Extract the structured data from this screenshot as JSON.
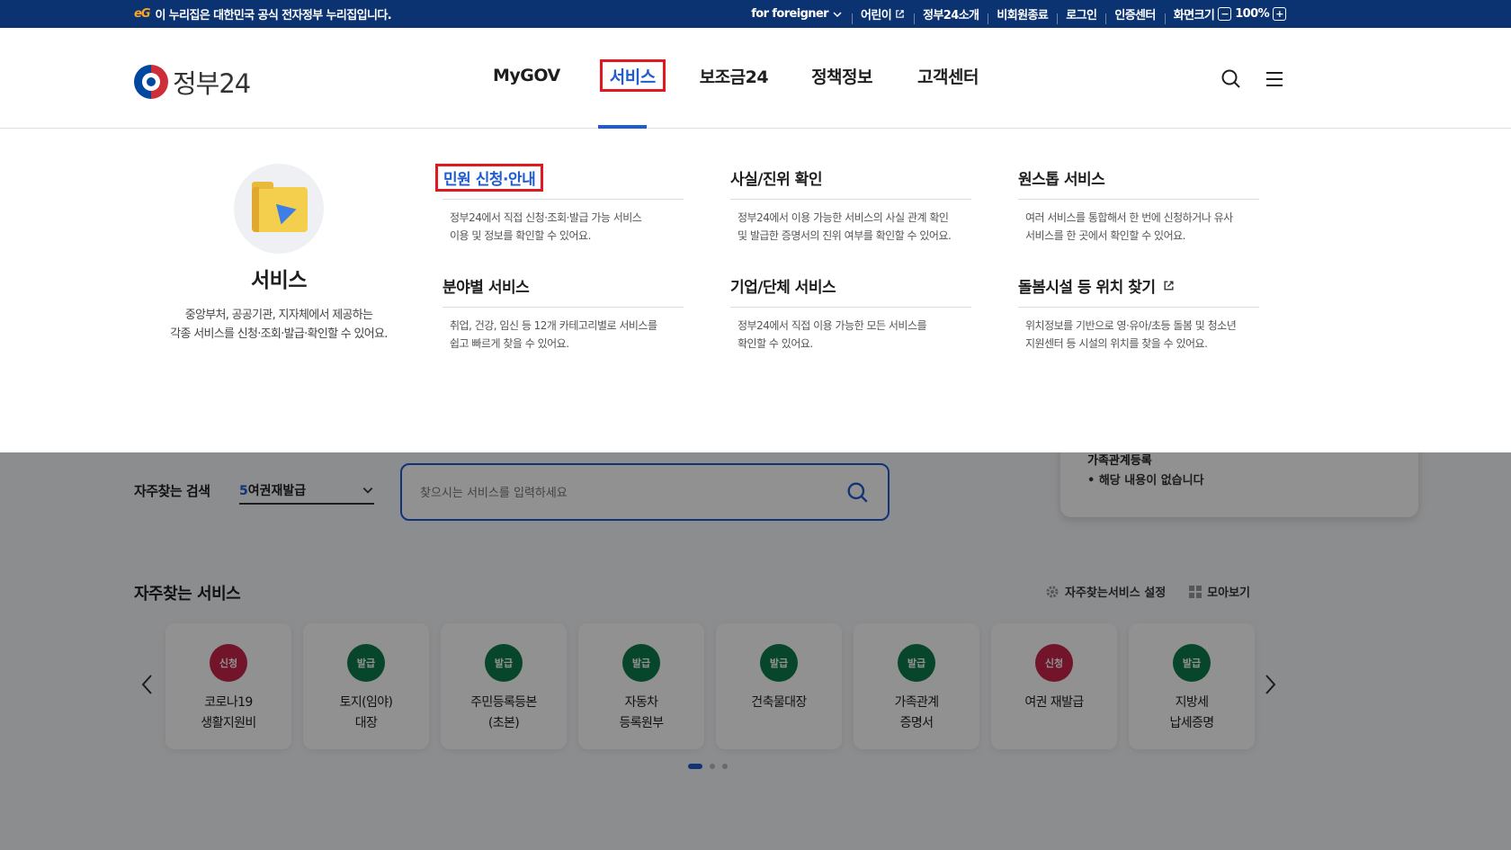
{
  "topbar": {
    "gov_logo": "eG",
    "gov_notice": "이 누리집은 대한민국 공식 전자정부 누리집입니다.",
    "links": [
      {
        "label": "for foreigner",
        "icon": "chevron-down-icon"
      },
      {
        "label": "어린이",
        "icon": "external-link-icon"
      },
      {
        "label": "정부24소개"
      },
      {
        "label": "비회원종료"
      },
      {
        "label": "로그인"
      },
      {
        "label": "인증센터"
      }
    ],
    "zoom_label": "화면크기",
    "zoom_value": "100%",
    "zoom_minus": "−",
    "zoom_plus": "+"
  },
  "header": {
    "logo_text": "정부24",
    "nav": [
      "MyGOV",
      "서비스",
      "보조금24",
      "정책정보",
      "고객센터"
    ],
    "active_nav_index": 1
  },
  "mega_menu": {
    "intro_title": "서비스",
    "intro_desc_1": "중앙부처, 공공기관, 지자체에서 제공하는",
    "intro_desc_2": "각종 서비스를 신청·조회·발급·확인할 수 있어요.",
    "items": [
      {
        "title": "민원 신청·안내",
        "desc_1": "정부24에서 직접 신청·조회·발급 가능 서비스",
        "desc_2": "이용 및 정보를 확인할 수 있어요."
      },
      {
        "title": "사실/진위 확인",
        "desc_1": "정부24에서 이용 가능한 서비스의 사실 관계 확인",
        "desc_2": "및 발급한 증명서의 진위 여부를 확인할 수 있어요."
      },
      {
        "title": "원스톱 서비스",
        "desc_1": "여러 서비스를 통합해서 한 번에 신청하거나 유사",
        "desc_2": "서비스를 한 곳에서 확인할 수 있어요."
      },
      {
        "title": "분야별 서비스",
        "desc_1": "취업, 건강, 임신 등 12개 카테고리별로 서비스를",
        "desc_2": "쉽고 빠르게 찾을 수 있어요."
      },
      {
        "title": "기업/단체 서비스",
        "desc_1": "정부24에서 직접 이용 가능한 모든 서비스를",
        "desc_2": "확인할 수 있어요."
      },
      {
        "title": "돌봄시설 등 위치 찾기",
        "desc_1": "위치정보를 기반으로 영·유아/초등 돌봄 및 청소년",
        "desc_2": "지원센터 등 시설의 위치를 찾을 수 있어요."
      }
    ]
  },
  "search": {
    "fav_label": "자주찾는 검색",
    "fav_number": "5",
    "fav_value": "여권재발급",
    "placeholder": "찾으시는 서비스를 입력하세요"
  },
  "notice": {
    "title_partial": "가족관계등록",
    "empty_text": "해당 내용이 없습니다"
  },
  "frequent": {
    "title": "자주찾는 서비스",
    "settings_label": "자주찾는서비스 설정",
    "view_all_label": "모아보기",
    "services": [
      {
        "badge": "신청",
        "line1": "코로나19",
        "line2": "생활지원비",
        "color": "#c8254c"
      },
      {
        "badge": "발급",
        "line1": "토지(임야)",
        "line2": "대장",
        "color": "#0e7b4a"
      },
      {
        "badge": "발급",
        "line1": "주민등록등본",
        "line2": "(초본)",
        "color": "#0e7b4a"
      },
      {
        "badge": "발급",
        "line1": "자동차",
        "line2": "등록원부",
        "color": "#0e7b4a"
      },
      {
        "badge": "발급",
        "line1": "건축물대장",
        "line2": "",
        "color": "#0e7b4a"
      },
      {
        "badge": "발급",
        "line1": "가족관계",
        "line2": "증명서",
        "color": "#0e7b4a"
      },
      {
        "badge": "신청",
        "line1": "여권 재발급",
        "line2": "",
        "color": "#c8254c"
      },
      {
        "badge": "발급",
        "line1": "지방세",
        "line2": "납세증명",
        "color": "#0e7b4a"
      }
    ]
  },
  "colors": {
    "primary": "#1f5bd1",
    "highlight_box": "#e0181f",
    "topbar": "#0c3371"
  }
}
